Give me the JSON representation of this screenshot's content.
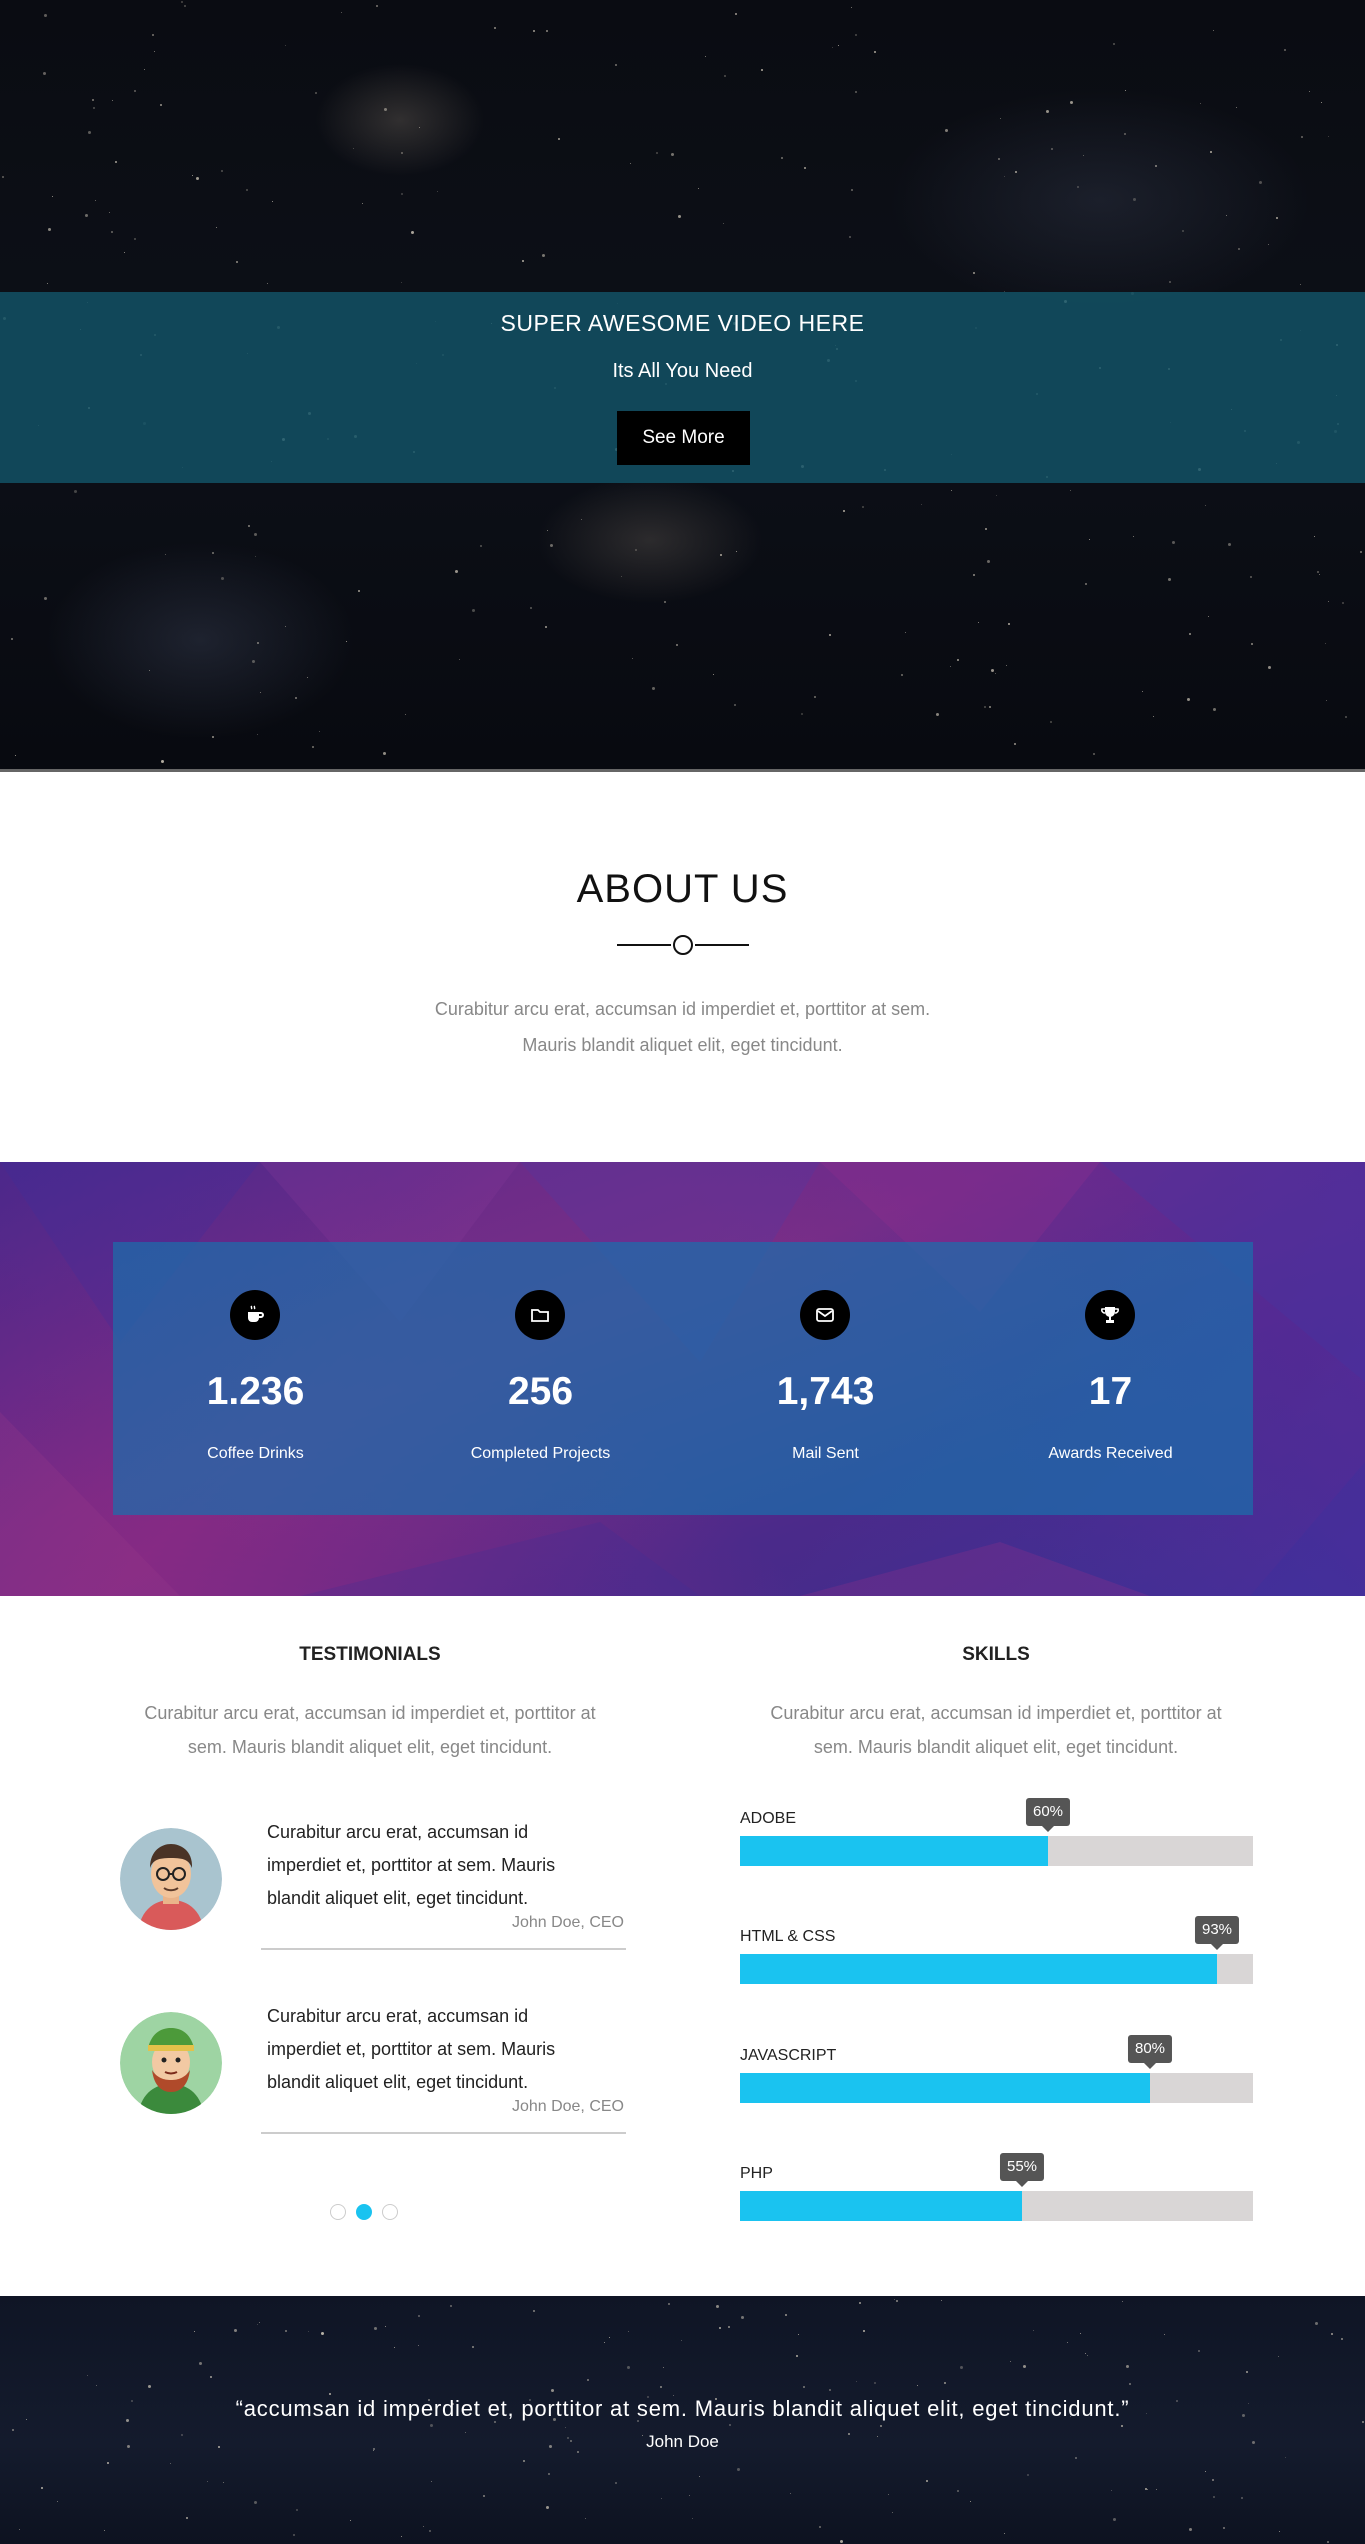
{
  "hero": {
    "title": "SUPER AWESOME VIDEO HERE",
    "subtitle": "Its All You Need",
    "button_label": "See More"
  },
  "about": {
    "title": "ABOUT US",
    "text_line1": "Curabitur arcu erat, accumsan id imperdiet et, porttitor at sem.",
    "text_line2": "Mauris blandit aliquet elit, eget tincidunt."
  },
  "stats": [
    {
      "icon": "coffee-cup-icon",
      "value": "1.236",
      "label": "Coffee Drinks"
    },
    {
      "icon": "folder-icon",
      "value": "256",
      "label": "Completed Projects"
    },
    {
      "icon": "envelope-icon",
      "value": "1,743",
      "label": "Mail Sent"
    },
    {
      "icon": "trophy-icon",
      "value": "17",
      "label": "Awards Received"
    }
  ],
  "testimonials": {
    "title": "TESTIMONIALS",
    "desc_line1": "Curabitur arcu erat, accumsan id imperdiet et, porttitor at",
    "desc_line2": "sem. Mauris blandit aliquet elit, eget tincidunt.",
    "items": [
      {
        "line1": "Curabitur arcu erat, accumsan id",
        "line2": "imperdiet et, porttitor at sem. Mauris",
        "line3": "blandit aliquet elit, eget tincidunt.",
        "author": "John Doe, CEO"
      },
      {
        "line1": "Curabitur arcu erat, accumsan id",
        "line2": "imperdiet et, porttitor at sem. Mauris",
        "line3": "blandit aliquet elit, eget tincidunt.",
        "author": "John Doe, CEO"
      }
    ],
    "active_dot": 1
  },
  "skills": {
    "title": "SKILLS",
    "desc_line1": "Curabitur arcu erat, accumsan id imperdiet et, porttitor at",
    "desc_line2": "sem. Mauris blandit aliquet elit, eget tincidunt.",
    "items": [
      {
        "name": "ADOBE",
        "percent": 60,
        "label": "60%"
      },
      {
        "name": "HTML & CSS",
        "percent": 93,
        "label": "93%"
      },
      {
        "name": "JAVASCRIPT",
        "percent": 80,
        "label": "80%"
      },
      {
        "name": "PHP",
        "percent": 55,
        "label": "55%"
      }
    ],
    "bar_color": "#1ac3f0",
    "track_color": "#d9d6d6"
  },
  "quote": {
    "text": "“accumsan id imperdiet et, porttitor at sem. Mauris blandit aliquet elit, eget tincidunt.”",
    "author": "John Doe"
  }
}
